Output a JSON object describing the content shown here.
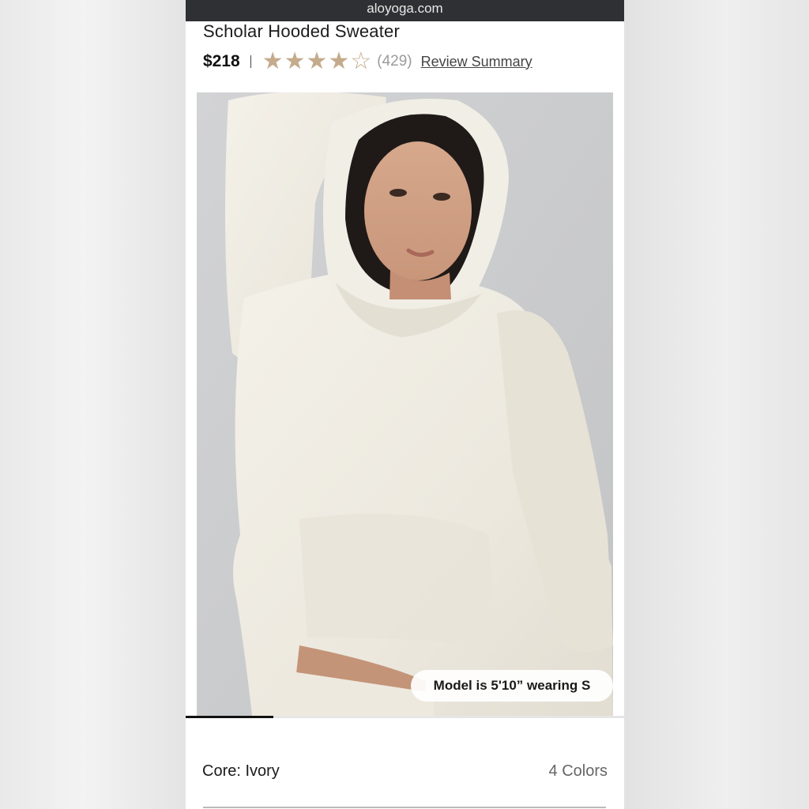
{
  "browser": {
    "url": "aloyoga.com"
  },
  "product": {
    "title": "Scholar Hooded Sweater",
    "price": "$218",
    "rating": {
      "value": 4,
      "max": 5,
      "count": "(429)"
    },
    "review_link": "Review Summary"
  },
  "gallery": {
    "model_note": "Model is 5'10” wearing S",
    "progress": 0.2
  },
  "color": {
    "label": "Core: Ivory",
    "options_count": "4 Colors"
  },
  "colors": {
    "star": "#c4ab8c",
    "url_bar": "#2f3033",
    "sweater": "#efebe1"
  }
}
